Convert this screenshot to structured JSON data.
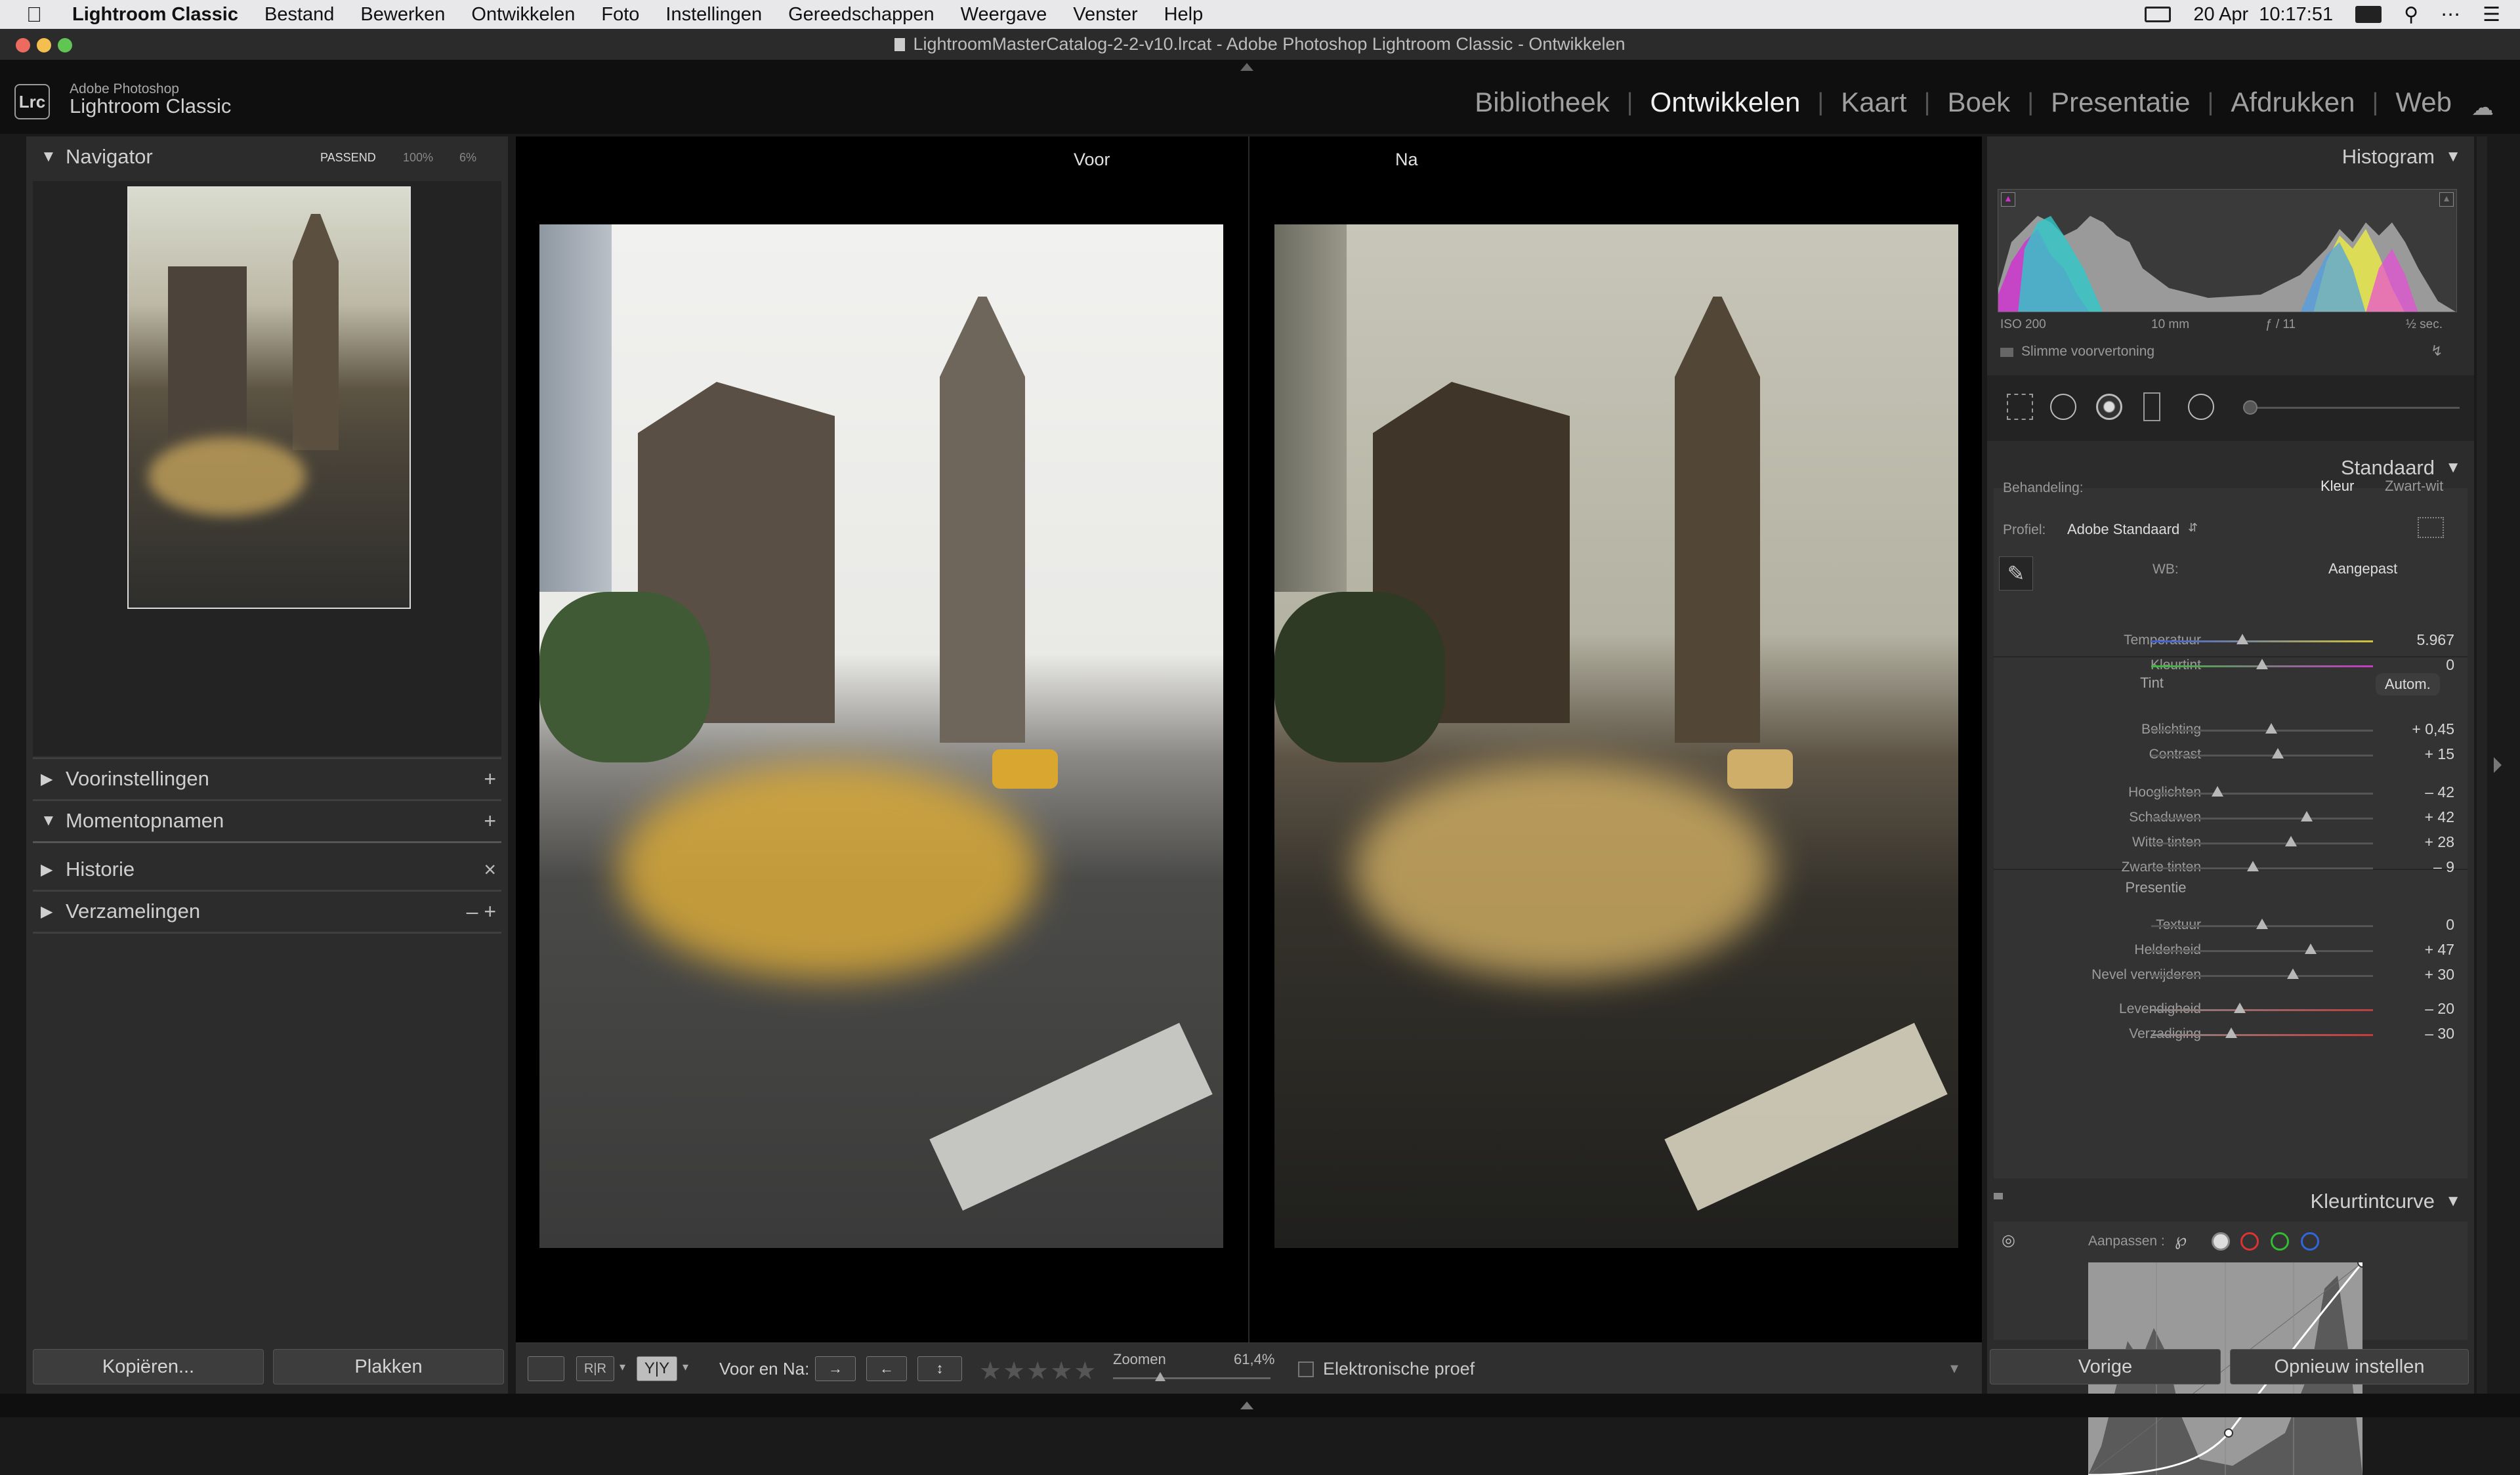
{
  "menubar": {
    "app_name": "Lightroom Classic",
    "items": [
      "Bestand",
      "Bewerken",
      "Ontwikkelen",
      "Foto",
      "Instellingen",
      "Gereedschappen",
      "Weergave",
      "Venster",
      "Help"
    ],
    "date": "20 Apr",
    "time": "10:17:51"
  },
  "window": {
    "title": "LightroomMasterCatalog-2-2-v10.lrcat - Adobe Photoshop Lightroom Classic - Ontwikkelen"
  },
  "header": {
    "logo_text": "Lrc",
    "brand_top": "Adobe Photoshop",
    "brand_bottom": "Lightroom Classic",
    "modules": [
      "Bibliotheek",
      "Ontwikkelen",
      "Kaart",
      "Boek",
      "Presentatie",
      "Afdrukken",
      "Web"
    ],
    "active_module": "Ontwikkelen"
  },
  "left_panel": {
    "navigator": {
      "title": "Navigator",
      "zoom_options": [
        "PASSEND",
        "100%",
        "6%"
      ]
    },
    "sections": [
      {
        "title": "Voorinstellingen",
        "action": "+"
      },
      {
        "title": "Momentopnamen",
        "action": "+"
      },
      {
        "title": "Historie",
        "action": "×"
      },
      {
        "title": "Verzamelingen",
        "action": "– +"
      }
    ],
    "copy_button": "Kopiëren...",
    "paste_button": "Plakken"
  },
  "center": {
    "before_label": "Voor",
    "after_label": "Na"
  },
  "toolbar": {
    "before_after_label": "Voor en Na:",
    "zoom_label": "Zoomen",
    "zoom_value": "61,4%",
    "zoom_level": 0.3,
    "soft_proof_label": "Elektronische proef",
    "rating_stars": "★★★★★"
  },
  "right_panel": {
    "histogram": {
      "title": "Histogram",
      "iso": "ISO 200",
      "focal": "10 mm",
      "aperture": "ƒ / 11",
      "shutter": "½ sec.",
      "smart_preview": "Slimme voorvertoning"
    },
    "basic": {
      "title": "Standaard",
      "treatment_label": "Behandeling:",
      "treatment_color": "Kleur",
      "treatment_bw": "Zwart-wit",
      "profile_label": "Profiel:",
      "profile_value": "Adobe Standaard",
      "wb_label": "WB:",
      "wb_value": "Aangepast",
      "tone_label": "Tint",
      "auto_button": "Autom.",
      "presence_label": "Presentie",
      "sliders": [
        {
          "label": "Temperatuur",
          "value": "5.967",
          "pos": 0.41
        },
        {
          "label": "Kleurtint",
          "value": "0",
          "pos": 0.5
        },
        {
          "label": "Belichting",
          "value": "+ 0,45",
          "pos": 0.54
        },
        {
          "label": "Contrast",
          "value": "+ 15",
          "pos": 0.57
        },
        {
          "label": "Hooglichten",
          "value": "– 42",
          "pos": 0.3
        },
        {
          "label": "Schaduwen",
          "value": "+ 42",
          "pos": 0.7
        },
        {
          "label": "Witte tinten",
          "value": "+ 28",
          "pos": 0.63
        },
        {
          "label": "Zwarte tinten",
          "value": "– 9",
          "pos": 0.46
        },
        {
          "label": "Textuur",
          "value": "0",
          "pos": 0.5
        },
        {
          "label": "Helderheid",
          "value": "+ 47",
          "pos": 0.72
        },
        {
          "label": "Nevel verwijderen",
          "value": "+ 30",
          "pos": 0.64
        },
        {
          "label": "Levendigheid",
          "value": "– 20",
          "pos": 0.4
        },
        {
          "label": "Verzadiging",
          "value": "– 30",
          "pos": 0.36
        }
      ]
    },
    "tone_curve": {
      "title": "Kleurtintcurve",
      "adjust_label": "Aanpassen :"
    },
    "previous_button": "Vorige",
    "reset_button": "Opnieuw instellen"
  }
}
